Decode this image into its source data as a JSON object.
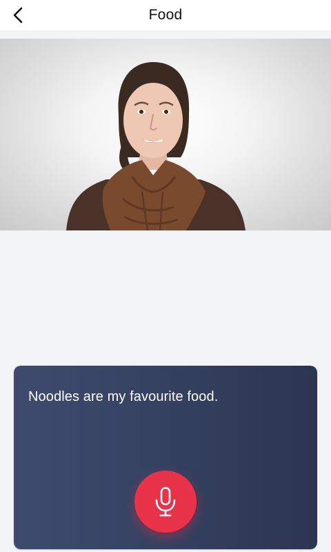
{
  "header": {
    "title": "Food",
    "back_icon": "chevron-left-icon"
  },
  "video": {
    "description_icon": "video-frame"
  },
  "card": {
    "sentence": "Noodles are my favourite food.",
    "mic_icon": "microphone-icon"
  },
  "colors": {
    "background": "#f2f3f5",
    "header_bg": "#ffffff",
    "card_gradient_start": "#3f4b6d",
    "card_gradient_end": "#2c3550",
    "mic_button": "#e8334a"
  }
}
